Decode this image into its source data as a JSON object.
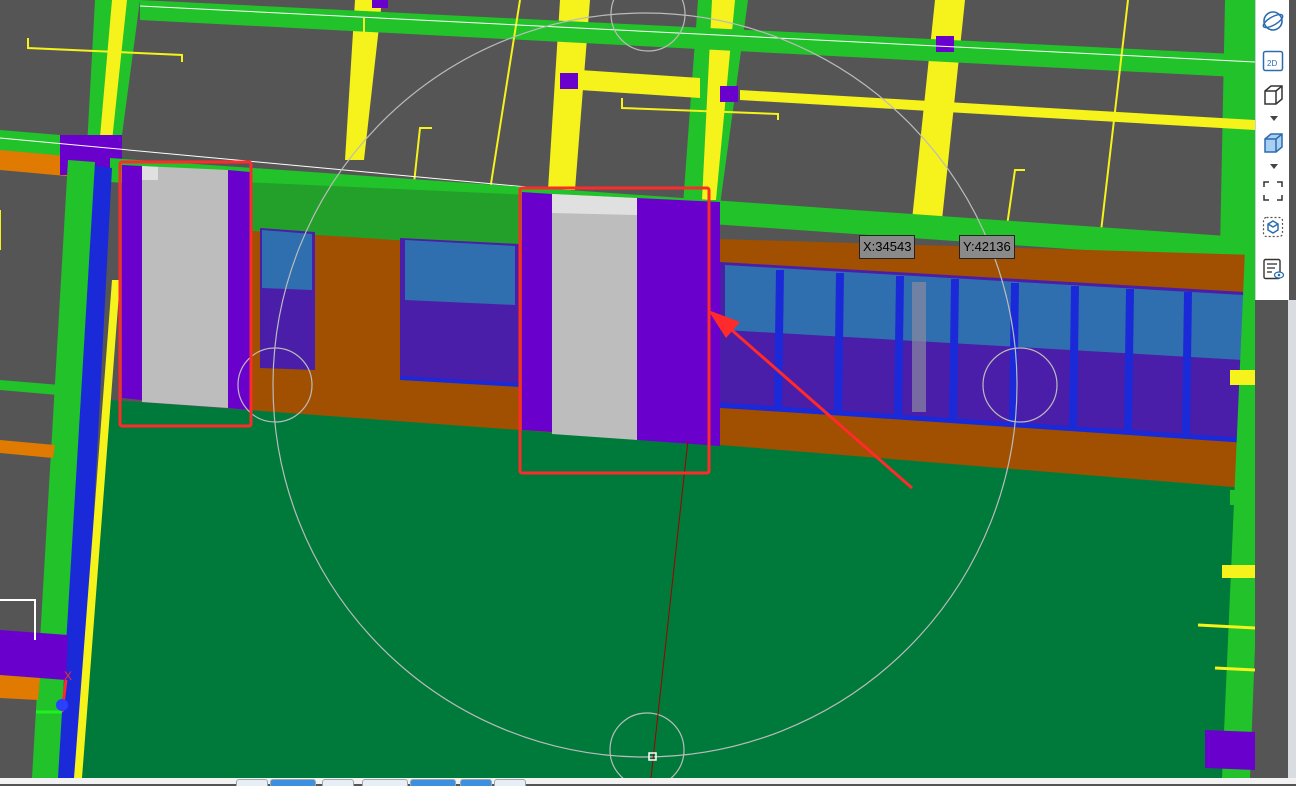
{
  "viewport": {
    "coord_x": "X:34543",
    "coord_y": "Y:42136"
  },
  "toolbar": {
    "items": [
      {
        "name": "orbit-icon"
      },
      {
        "name": "2d-view-icon",
        "label": "2D"
      },
      {
        "name": "3d-wireframe-icon"
      },
      {
        "name": "3d-shaded-icon"
      },
      {
        "name": "zoom-extents-icon"
      },
      {
        "name": "view-cube-icon"
      },
      {
        "name": "display-settings-icon"
      }
    ]
  },
  "colors": {
    "background": "#555555",
    "beam_green": "#22c22a",
    "beam_yellow": "#f6f21c",
    "column_purple": "#6a00cc",
    "wall_brown": "#a05000",
    "slab_green": "#007a3a",
    "window_blue": "#2f6fb0",
    "highlight_red": "#ff2a2a"
  }
}
